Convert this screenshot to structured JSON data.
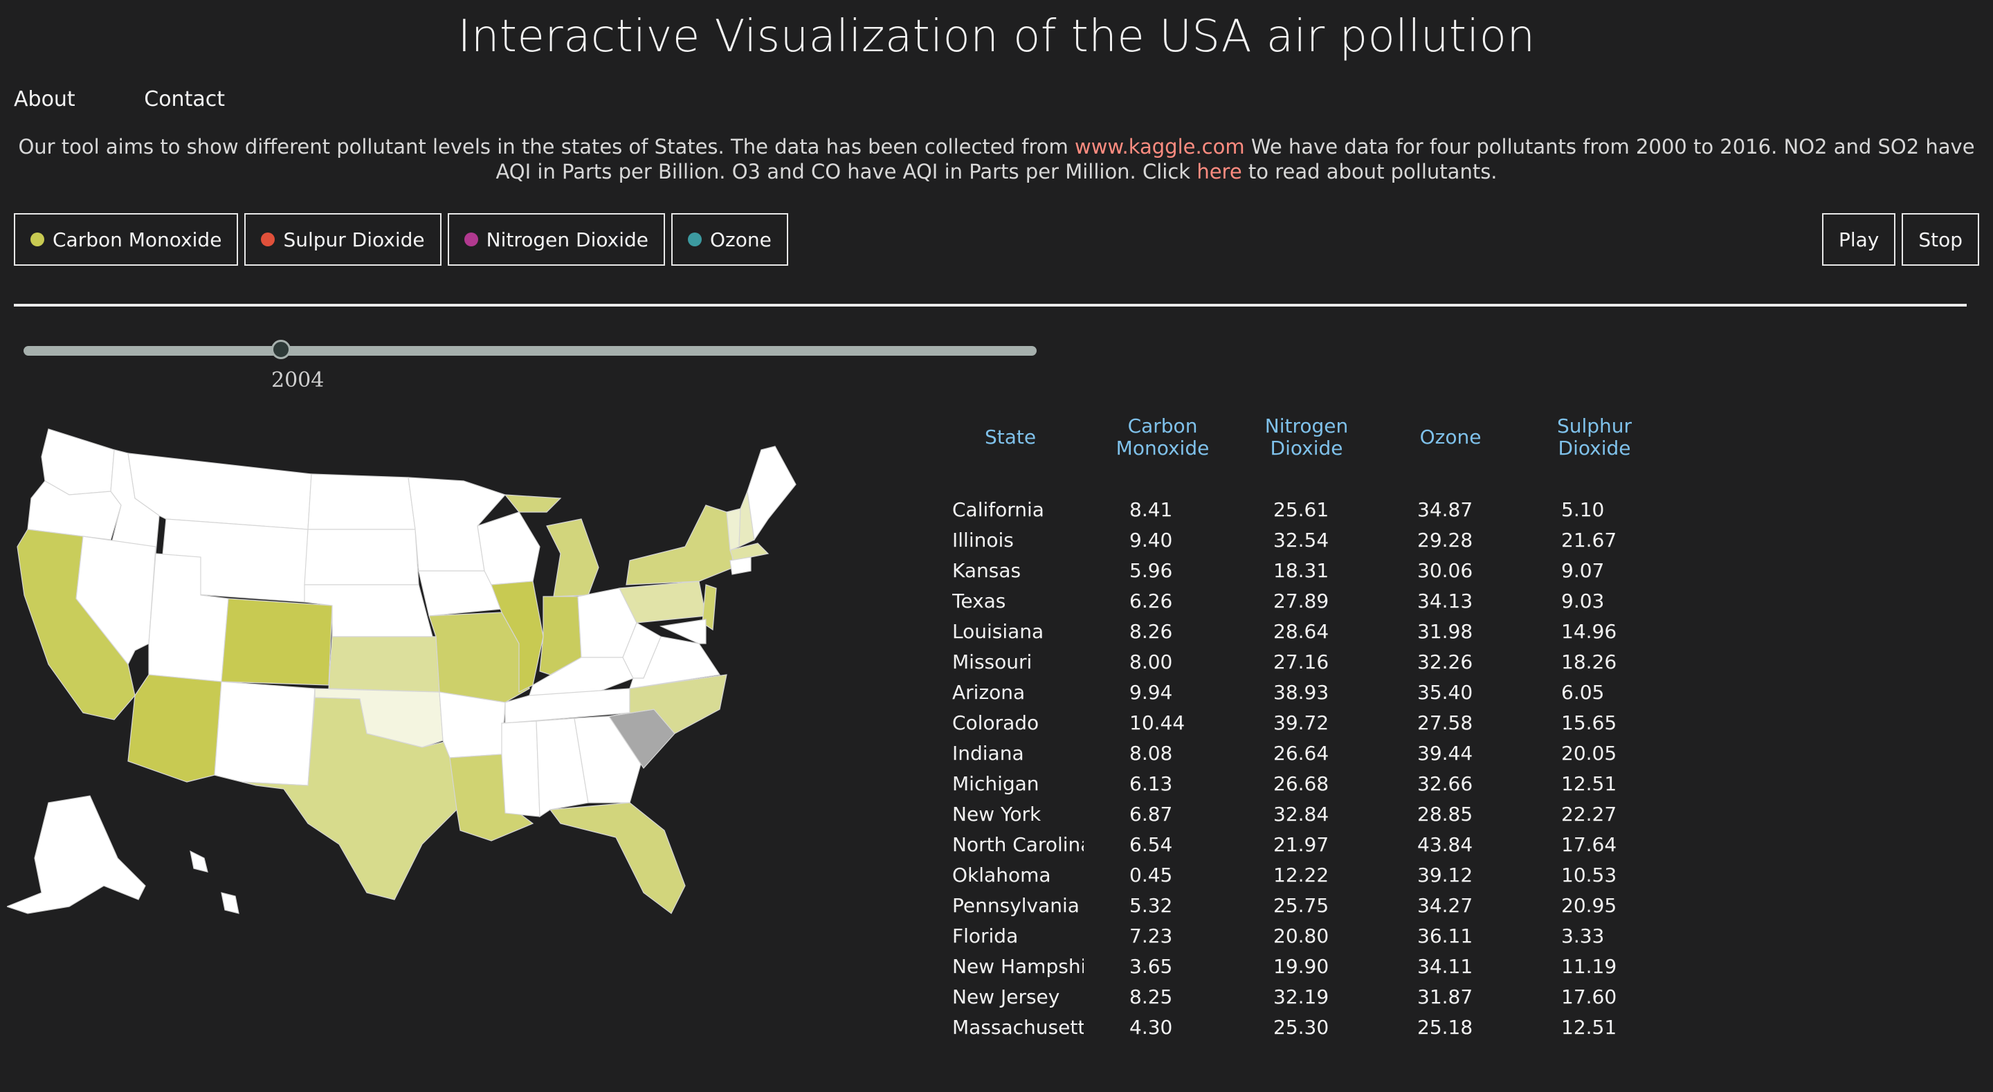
{
  "title": "Interactive Visualization of the USA air pollution",
  "nav": {
    "about": "About",
    "contact": "Contact"
  },
  "intro": {
    "part1": "Our tool aims to show different pollutant levels in the states of States. The data has been collected from ",
    "link1": "www.kaggle.com",
    "part2": " We have data for four pollutants from 2000 to 2016. NO2 and SO2 have AQI in Parts per Billion. O3 and CO have AQI in Parts per Million. Click ",
    "link2": "here",
    "part3": " to read about pollutants."
  },
  "pollutants": [
    {
      "label": "Carbon Monoxide",
      "color": "#c8ca52"
    },
    {
      "label": "Sulpur Dioxide",
      "color": "#e0503a"
    },
    {
      "label": "Nitrogen Dioxide",
      "color": "#b1398f"
    },
    {
      "label": "Ozone",
      "color": "#3c9aa0"
    }
  ],
  "controls": {
    "play": "Play",
    "stop": "Stop"
  },
  "slider": {
    "year": "2004",
    "min": 2000,
    "max": 2016
  },
  "table": {
    "headers": {
      "state": "State",
      "co1": "Carbon",
      "co2": "Monoxide",
      "no1": "Nitrogen",
      "no2": "Dioxide",
      "o3": "Ozone",
      "so1": "Sulphur",
      "so2": "Dioxide"
    },
    "rows": [
      {
        "state": "California",
        "co": "8.41",
        "no2": "25.61",
        "o3": "34.87",
        "so2": "5.10"
      },
      {
        "state": "Illinois",
        "co": "9.40",
        "no2": "32.54",
        "o3": "29.28",
        "so2": "21.67"
      },
      {
        "state": "Kansas",
        "co": "5.96",
        "no2": "18.31",
        "o3": "30.06",
        "so2": "9.07"
      },
      {
        "state": "Texas",
        "co": "6.26",
        "no2": "27.89",
        "o3": "34.13",
        "so2": "9.03"
      },
      {
        "state": "Louisiana",
        "co": "8.26",
        "no2": "28.64",
        "o3": "31.98",
        "so2": "14.96"
      },
      {
        "state": "Missouri",
        "co": "8.00",
        "no2": "27.16",
        "o3": "32.26",
        "so2": "18.26"
      },
      {
        "state": "Arizona",
        "co": "9.94",
        "no2": "38.93",
        "o3": "35.40",
        "so2": "6.05"
      },
      {
        "state": "Colorado",
        "co": "10.44",
        "no2": "39.72",
        "o3": "27.58",
        "so2": "15.65"
      },
      {
        "state": "Indiana",
        "co": "8.08",
        "no2": "26.64",
        "o3": "39.44",
        "so2": "20.05"
      },
      {
        "state": "Michigan",
        "co": "6.13",
        "no2": "26.68",
        "o3": "32.66",
        "so2": "12.51"
      },
      {
        "state": "New York",
        "co": "6.87",
        "no2": "32.84",
        "o3": "28.85",
        "so2": "22.27"
      },
      {
        "state": "North Carolina",
        "co": "6.54",
        "no2": "21.97",
        "o3": "43.84",
        "so2": "17.64"
      },
      {
        "state": "Oklahoma",
        "co": "0.45",
        "no2": "12.22",
        "o3": "39.12",
        "so2": "10.53"
      },
      {
        "state": "Pennsylvania",
        "co": "5.32",
        "no2": "25.75",
        "o3": "34.27",
        "so2": "20.95"
      },
      {
        "state": "Florida",
        "co": "7.23",
        "no2": "20.80",
        "o3": "36.11",
        "so2": "3.33"
      },
      {
        "state": "New Hampshir",
        "co": "3.65",
        "no2": "19.90",
        "o3": "34.11",
        "so2": "11.19"
      },
      {
        "state": "New Jersey",
        "co": "8.25",
        "no2": "32.19",
        "o3": "31.87",
        "so2": "17.60"
      },
      {
        "state": "Massachusetts",
        "co": "4.30",
        "no2": "25.30",
        "o3": "25.18",
        "so2": "12.51"
      }
    ]
  },
  "map_colors": {
    "no_data": "#ffffff",
    "selected": "#a8a8a8",
    "border": "#d6d6d6"
  }
}
